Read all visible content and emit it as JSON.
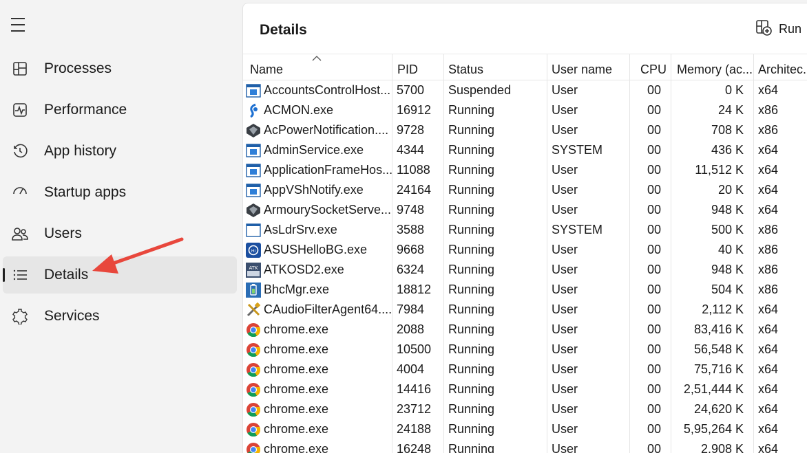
{
  "sidebar": {
    "items": [
      {
        "label": "Processes",
        "icon": "processes-icon"
      },
      {
        "label": "Performance",
        "icon": "performance-icon"
      },
      {
        "label": "App history",
        "icon": "app-history-icon"
      },
      {
        "label": "Startup apps",
        "icon": "startup-apps-icon"
      },
      {
        "label": "Users",
        "icon": "users-icon"
      },
      {
        "label": "Details",
        "icon": "details-icon",
        "active": true
      },
      {
        "label": "Services",
        "icon": "services-icon"
      }
    ]
  },
  "header": {
    "title": "Details",
    "run_label": "Run"
  },
  "table": {
    "columns": [
      "Name",
      "PID",
      "Status",
      "User name",
      "CPU",
      "Memory (ac...",
      "Architec..."
    ],
    "rows": [
      {
        "name": "AccountsControlHost...",
        "pid": "5700",
        "status": "Suspended",
        "user": "User",
        "cpu": "00",
        "mem": "0 K",
        "arch": "x64",
        "icon": "window-icon"
      },
      {
        "name": "ACMON.exe",
        "pid": "16912",
        "status": "Running",
        "user": "User",
        "cpu": "00",
        "mem": "24 K",
        "arch": "x86",
        "icon": "acmon-icon"
      },
      {
        "name": "AcPowerNotification....",
        "pid": "9728",
        "status": "Running",
        "user": "User",
        "cpu": "00",
        "mem": "708 K",
        "arch": "x86",
        "icon": "armoury-icon"
      },
      {
        "name": "AdminService.exe",
        "pid": "4344",
        "status": "Running",
        "user": "SYSTEM",
        "cpu": "00",
        "mem": "436 K",
        "arch": "x64",
        "icon": "window-icon"
      },
      {
        "name": "ApplicationFrameHos...",
        "pid": "11088",
        "status": "Running",
        "user": "User",
        "cpu": "00",
        "mem": "11,512 K",
        "arch": "x64",
        "icon": "window-icon"
      },
      {
        "name": "AppVShNotify.exe",
        "pid": "24164",
        "status": "Running",
        "user": "User",
        "cpu": "00",
        "mem": "20 K",
        "arch": "x64",
        "icon": "window-icon"
      },
      {
        "name": "ArmourySocketServe...",
        "pid": "9748",
        "status": "Running",
        "user": "User",
        "cpu": "00",
        "mem": "948 K",
        "arch": "x64",
        "icon": "armoury-icon"
      },
      {
        "name": "AsLdrSrv.exe",
        "pid": "3588",
        "status": "Running",
        "user": "SYSTEM",
        "cpu": "00",
        "mem": "500 K",
        "arch": "x86",
        "icon": "blank-window-icon"
      },
      {
        "name": "ASUSHelloBG.exe",
        "pid": "9668",
        "status": "Running",
        "user": "User",
        "cpu": "00",
        "mem": "40 K",
        "arch": "x86",
        "icon": "asus-hello-icon"
      },
      {
        "name": "ATKOSD2.exe",
        "pid": "6324",
        "status": "Running",
        "user": "User",
        "cpu": "00",
        "mem": "948 K",
        "arch": "x86",
        "icon": "atk-icon"
      },
      {
        "name": "BhcMgr.exe",
        "pid": "18812",
        "status": "Running",
        "user": "User",
        "cpu": "00",
        "mem": "504 K",
        "arch": "x86",
        "icon": "battery-icon"
      },
      {
        "name": "CAudioFilterAgent64....",
        "pid": "7984",
        "status": "Running",
        "user": "User",
        "cpu": "00",
        "mem": "2,112 K",
        "arch": "x64",
        "icon": "tools-icon"
      },
      {
        "name": "chrome.exe",
        "pid": "2088",
        "status": "Running",
        "user": "User",
        "cpu": "00",
        "mem": "83,416 K",
        "arch": "x64",
        "icon": "chrome-icon"
      },
      {
        "name": "chrome.exe",
        "pid": "10500",
        "status": "Running",
        "user": "User",
        "cpu": "00",
        "mem": "56,548 K",
        "arch": "x64",
        "icon": "chrome-icon"
      },
      {
        "name": "chrome.exe",
        "pid": "4004",
        "status": "Running",
        "user": "User",
        "cpu": "00",
        "mem": "75,716 K",
        "arch": "x64",
        "icon": "chrome-icon"
      },
      {
        "name": "chrome.exe",
        "pid": "14416",
        "status": "Running",
        "user": "User",
        "cpu": "00",
        "mem": "2,51,444 K",
        "arch": "x64",
        "icon": "chrome-icon"
      },
      {
        "name": "chrome.exe",
        "pid": "23712",
        "status": "Running",
        "user": "User",
        "cpu": "00",
        "mem": "24,620 K",
        "arch": "x64",
        "icon": "chrome-icon"
      },
      {
        "name": "chrome.exe",
        "pid": "24188",
        "status": "Running",
        "user": "User",
        "cpu": "00",
        "mem": "5,95,264 K",
        "arch": "x64",
        "icon": "chrome-icon"
      },
      {
        "name": "chrome.exe",
        "pid": "16248",
        "status": "Running",
        "user": "User",
        "cpu": "00",
        "mem": "2,908 K",
        "arch": "x64",
        "icon": "chrome-icon"
      }
    ]
  },
  "colors": {
    "arrow": "#e8473c",
    "sidebar_bg": "#f3f3f3",
    "active_item_bg": "#e6e6e6"
  }
}
